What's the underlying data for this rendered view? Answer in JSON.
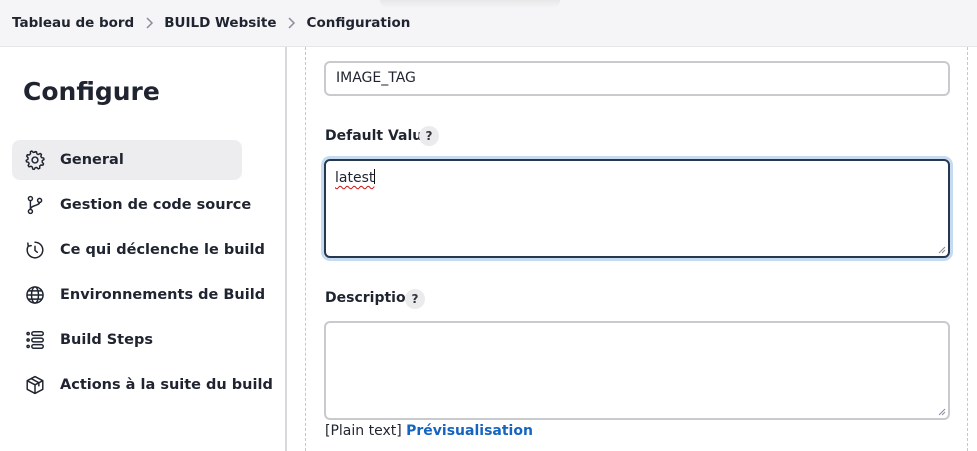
{
  "breadcrumb": {
    "items": [
      "Tableau de bord",
      "BUILD Website",
      "Configuration"
    ]
  },
  "sidebar": {
    "title": "Configure",
    "items": [
      {
        "label": "General",
        "icon": "gear-icon",
        "active": true
      },
      {
        "label": "Gestion de code source",
        "icon": "branch-icon",
        "active": false
      },
      {
        "label": "Ce qui déclenche le build",
        "icon": "clock-icon",
        "active": false
      },
      {
        "label": "Environnements de Build",
        "icon": "globe-icon",
        "active": false
      },
      {
        "label": "Build Steps",
        "icon": "list-icon",
        "active": false
      },
      {
        "label": "Actions à la suite du build",
        "icon": "package-icon",
        "active": false
      }
    ]
  },
  "form": {
    "name_value": "IMAGE_TAG",
    "default_value_label": "Default Value",
    "default_value": "latest",
    "description_label": "Description",
    "description_value": "",
    "help_glyph": "?",
    "plain_text_note": "[Plain text]",
    "preview_link": "Prévisualisation"
  },
  "colors": {
    "accent_link": "#1565c0",
    "focus_border": "#26384f",
    "focus_ring": "#c6dbef",
    "active_nav_bg": "#ededf0"
  }
}
